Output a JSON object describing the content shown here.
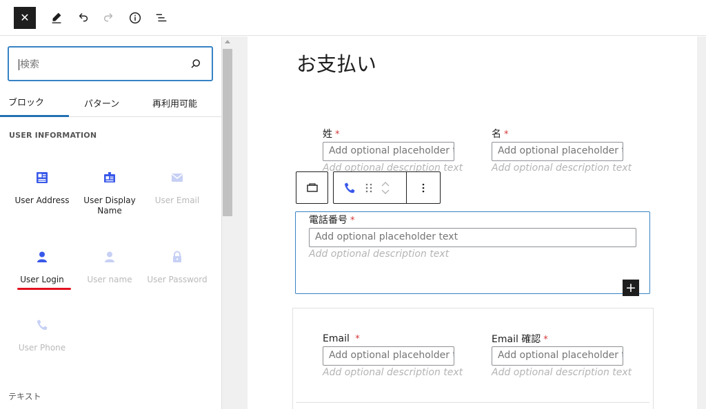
{
  "toolbar": {
    "close_icon": "close-icon",
    "edit_icon": "pencil-icon",
    "undo_icon": "undo-icon",
    "redo_icon": "redo-icon",
    "info_icon": "info-icon",
    "list_view_icon": "list-view-icon"
  },
  "sidebar": {
    "search_placeholder": "検索",
    "tabs": [
      {
        "label": "ブロック",
        "active": true
      },
      {
        "label": "パターン",
        "active": false
      },
      {
        "label": "再利用可能",
        "active": false
      }
    ],
    "section_title": "USER INFORMATION",
    "blocks": [
      {
        "label": "User Address",
        "icon": "address-card-icon",
        "disabled": false
      },
      {
        "label": "User Display Name",
        "icon": "id-badge-icon",
        "disabled": false
      },
      {
        "label": "User Email",
        "icon": "envelope-icon",
        "disabled": true
      },
      {
        "label": "User Login",
        "icon": "user-icon",
        "disabled": false,
        "highlighted": true
      },
      {
        "label": "User name",
        "icon": "user-icon",
        "disabled": true
      },
      {
        "label": "User Password",
        "icon": "lock-icon",
        "disabled": true
      },
      {
        "label": "User Phone",
        "icon": "phone-icon",
        "disabled": true
      }
    ],
    "next_section_title": "テキスト"
  },
  "editor": {
    "page_title": "お支払い",
    "required_mark": "*",
    "fields": {
      "last_name": {
        "label": "姓",
        "placeholder": "Add optional placeholder t",
        "description": "Add optional description text"
      },
      "first_name": {
        "label": "名",
        "placeholder": "Add optional placeholder t",
        "description": "Add optional description text"
      },
      "phone": {
        "label": "電話番号",
        "placeholder": "Add optional placeholder text",
        "description": "Add optional description text"
      },
      "email": {
        "label": "Email",
        "placeholder": "Add optional placeholder t",
        "description": "Add optional description text"
      },
      "email_confirm": {
        "label": "Email 確認",
        "placeholder": "Add optional placeholder t",
        "description": "Add optional description text"
      }
    },
    "add_block_label": "+"
  },
  "colors": {
    "accent": "#3582c4",
    "block_icon": "#3858e9",
    "disabled_icon": "#c7d0f5",
    "required": "#d63638",
    "highlight_underline": "#e1101f"
  }
}
